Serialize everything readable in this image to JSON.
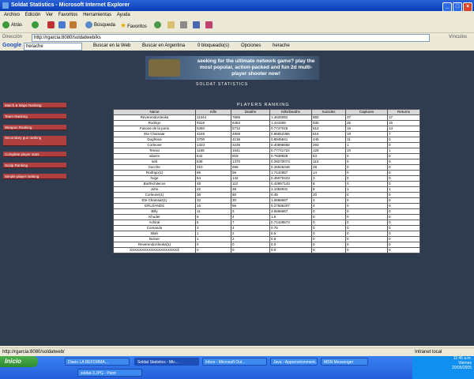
{
  "window": {
    "title": "Soldat Statistics - Microsoft Internet Explorer"
  },
  "menu": [
    "Archivo",
    "Edición",
    "Ver",
    "Favoritos",
    "Herramientas",
    "Ayuda"
  ],
  "toolbar": {
    "back": "Atrás",
    "search": "Búsqueda",
    "favorites": "Favoritos"
  },
  "address": {
    "label": "Dirección",
    "url": "http://rgarcia:8080/soldatweb/ks",
    "links": "Vínculos"
  },
  "google": {
    "label": "Google",
    "query": "herache",
    "search_web": "Buscar en la Web",
    "search_country": "Buscar en Argentina",
    "blocked": "0 bloqueado(s)",
    "options": "Opciones",
    "term": "herache"
  },
  "banner": {
    "text": "seeking for the ultimate network game? play the most popular, action-packed and fun 2d multi-player shooter now!"
  },
  "site": {
    "title": "SOLDAT STATISTICS"
  },
  "nav": [
    "Match & Maps Ranking",
    "Team Ranking",
    "Weapon Ranking",
    "Secondary gun ranking",
    "Complete player stats",
    "Scalp Ranking",
    "Simple player ranking"
  ],
  "ranking": {
    "title": "PLAYERS RANKING",
    "columns": [
      "Name",
      "Kills",
      "Deaths",
      "Kills/Deaths",
      "Suicides",
      "Captures",
      "Returns"
    ],
    "rows": [
      [
        "ReverendoAleoka",
        "11344",
        "7655",
        "1.4625091",
        "550",
        "37",
        "17"
      ],
      [
        "Rodrigo",
        "9316",
        "6463",
        "1.441659",
        "930",
        "25",
        "15"
      ],
      [
        "Fasone de la pone",
        "5260",
        "5712",
        "0.7747018",
        "612",
        "16",
        "13"
      ],
      [
        "Ete Chamaar",
        "4248",
        "4908",
        "0.86552366",
        "516",
        "19",
        "7"
      ],
      [
        "Dogfresa",
        "3700",
        "4136",
        "0.8945841",
        "445",
        "11",
        "0"
      ],
      [
        "Corleone",
        "1323",
        "3235",
        "0.40896555",
        "293",
        "1",
        "0"
      ],
      [
        "Tensio",
        "1165",
        "1541",
        "0.77741724",
        "129",
        "10",
        "1"
      ],
      [
        "abarre",
        "642",
        "819",
        "0.7838828",
        "63",
        "0",
        "0"
      ],
      [
        "seb",
        "538",
        "1370",
        "0.39270073",
        "113",
        "0",
        "0"
      ],
      [
        "bocche",
        "310",
        "666",
        "0.46546346",
        "28",
        "0",
        "0"
      ],
      [
        "Rodrigo(1)",
        "96",
        "56",
        "1.7142857",
        "14",
        "0",
        "0"
      ],
      [
        "huge",
        "64",
        "142",
        "0.45070423",
        "3",
        "0",
        "0"
      ],
      [
        "BiaTechitecos",
        "48",
        "112",
        "0.42857143",
        "8",
        "0",
        "0"
      ],
      [
        "John",
        "22",
        "38",
        "1.1052631",
        "8",
        "1",
        "1"
      ],
      [
        "Corleone(1)",
        "36",
        "80",
        "0.45",
        "20",
        "0",
        "0"
      ],
      [
        "Ete Chamaar(1)",
        "32",
        "30",
        "1.0666667",
        "4",
        "0",
        "0"
      ],
      [
        "ERLOANDS",
        "16",
        "56",
        "0.27586207",
        "4",
        "0",
        "0"
      ],
      [
        "Billy",
        "11",
        "3",
        "3.6666667",
        "0",
        "0",
        "0"
      ],
      [
        "Khuder",
        "6",
        "4",
        "1.5",
        "0",
        "0",
        "0"
      ],
      [
        "Achiral",
        "5",
        "7",
        "0.71428573",
        "0",
        "0",
        "0"
      ],
      [
        "Comando",
        "3",
        "4",
        "0.75",
        "0",
        "0",
        "0"
      ],
      [
        "Blah",
        "1",
        "2",
        "0.5",
        "0",
        "0",
        "0"
      ],
      [
        "Boloer",
        "1",
        "2",
        "0.5",
        "0",
        "0",
        "0"
      ],
      [
        "ReverendoAleoka(1)",
        "0",
        "0",
        "0.0",
        "0",
        "0",
        "0"
      ],
      [
        "XXXXXXXXXXXXXXXXXXXXX",
        "0",
        "0",
        "0.0",
        "0",
        "0",
        "0"
      ]
    ]
  },
  "status": {
    "url": "http://rgarcia:8080/soldatweb/",
    "zone": "Intranet local"
  },
  "taskbar": {
    "start": "Inicio",
    "tasks": [
      "Diario LA REFORMA...",
      "soldat-3.JPG - Paint",
      "Soldat Statistics - Mic...",
      "Inbox - Microsoft Out...",
      "Java - Apprenvironment...",
      "MSN Messenger"
    ],
    "time": "11:45 a.m.",
    "day": "Viernes",
    "date": "20/05/2005"
  }
}
